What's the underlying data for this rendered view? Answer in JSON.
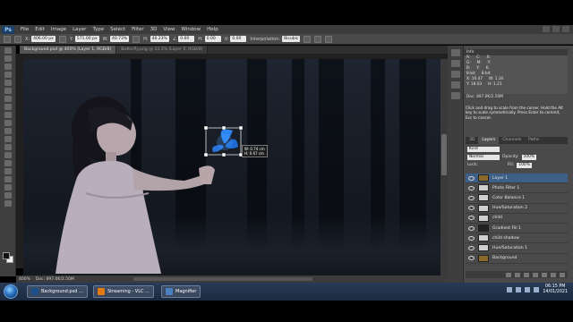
{
  "app": {
    "logo": "Ps"
  },
  "menu": [
    "File",
    "Edit",
    "Image",
    "Layer",
    "Type",
    "Select",
    "Filter",
    "3D",
    "View",
    "Window",
    "Help"
  ],
  "options": {
    "x": {
      "label": "X:",
      "value": "406.00 px"
    },
    "y": {
      "label": "Y:",
      "value": "571.00 px"
    },
    "w": {
      "label": "W:",
      "value": "40.73%"
    },
    "h": {
      "label": "H:",
      "value": "40.23%"
    },
    "angle": {
      "value": "0.00"
    },
    "hskew": {
      "label": "H:",
      "value": "0.00"
    },
    "vskew": {
      "label": "V:",
      "value": "0.00"
    },
    "interpolation": {
      "label": "Interpolation:",
      "value": "Bicubic"
    }
  },
  "tabs": [
    {
      "label": "Background.psd @ 400% (Layer 1, RGB/8)",
      "active": true
    },
    {
      "label": "Butterfly.png @ 33.3% (Layer 0, RGB/8)",
      "active": false
    }
  ],
  "transform_tooltip": {
    "w": "W: 0.74 cm",
    "h": "H: 0.67 cm"
  },
  "status": {
    "zoom": "400%",
    "doc": "Doc: 897.0K/2.50M"
  },
  "info_panel": {
    "title": "Info",
    "rows": [
      {
        "a": "R:",
        "b": "C:",
        "c": "X:"
      },
      {
        "a": "G:",
        "b": "M:",
        "c": "Y:"
      },
      {
        "a": "B:",
        "b": "Y:",
        "c": "K:"
      },
      {
        "a": "8-bit",
        "b": "8-bit",
        "c": ""
      },
      {
        "a": "X: 16.47",
        "b": "W: 1.34",
        "c": ""
      },
      {
        "a": "Y: 18.03",
        "b": "H: 1.21",
        "c": ""
      },
      {
        "a": "Doc: 897.0K/2.50M",
        "b": "",
        "c": ""
      }
    ],
    "message": "Click and drag to scale from the corner. Hold the Alt key to scale symmetrically. Press Enter to commit, Esc to cancel."
  },
  "panel_tabs": [
    {
      "label": "3D",
      "active": false
    },
    {
      "label": "Layers",
      "active": true
    },
    {
      "label": "Channels",
      "active": false
    },
    {
      "label": "Paths",
      "active": false
    }
  ],
  "layer_options": {
    "kind": "Kind",
    "blend": "Normal",
    "opacity_label": "Opacity:",
    "opacity": "100%",
    "lock_label": "Lock:",
    "fill_label": "Fill:",
    "fill": "100%"
  },
  "layers": [
    {
      "name": "Layer 1",
      "thumb": "img",
      "selected": true
    },
    {
      "name": "Photo Filter 1",
      "thumb": "adj",
      "selected": false
    },
    {
      "name": "Color Balance 1",
      "thumb": "adj",
      "selected": false
    },
    {
      "name": "Hue/Saturation 2",
      "thumb": "adj",
      "selected": false
    },
    {
      "name": "child",
      "thumb": "adj",
      "selected": false
    },
    {
      "name": "Gradient Fill 1",
      "thumb": "dark",
      "selected": false
    },
    {
      "name": "child shadow",
      "thumb": "adj",
      "selected": false
    },
    {
      "name": "Hue/Saturation 1",
      "thumb": "adj",
      "selected": false
    },
    {
      "name": "Background",
      "thumb": "img",
      "selected": false
    }
  ],
  "taskbar": {
    "buttons": [
      {
        "label": "Background.psd ...",
        "icon_color": "#1d4f8a"
      },
      {
        "label": "Streaming - VLC ...",
        "icon_color": "#e07a10"
      },
      {
        "label": "Magnifier",
        "icon_color": "#4a7fc0"
      }
    ],
    "time": "06:15 PM",
    "date": "14/01/2021"
  },
  "colors": {
    "accent": "#3e5f87",
    "butterfly": "#2f8cff"
  }
}
